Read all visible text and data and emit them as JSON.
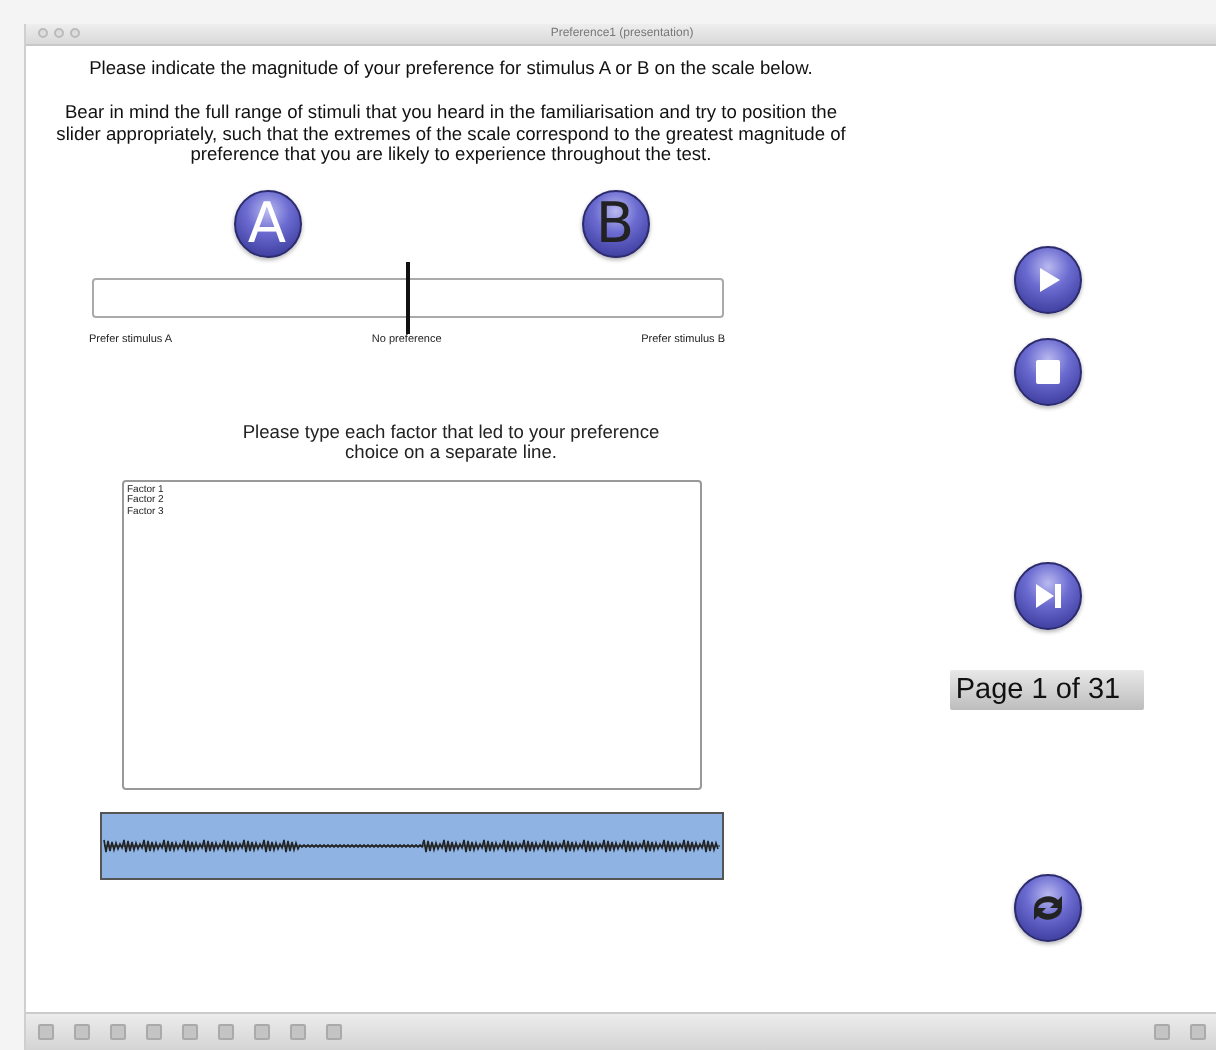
{
  "window": {
    "title": "Preference1 (presentation)"
  },
  "instruction": "Please indicate the magnitude of your preference for stimulus A or B on the scale below.",
  "guidance": "Bear in mind the full range of stimuli that you heard in the familiarisation and try to position the slider appropriately, such that the extremes of the scale correspond to the greatest magnitude of preference that you are likely to experience throughout the test.",
  "stimulus_buttons": [
    "A",
    "B"
  ],
  "slider": {
    "level": 0.5,
    "labels": [
      "Prefer stimulus A",
      "No preference",
      "Prefer stimulus B"
    ]
  },
  "factor_prompt": "Please type each factor that led to your preference choice on a separate line.",
  "factors": [
    "Factor 1",
    "Factor 2",
    "Factor 3"
  ],
  "page_label": "Page 1 of 31"
}
